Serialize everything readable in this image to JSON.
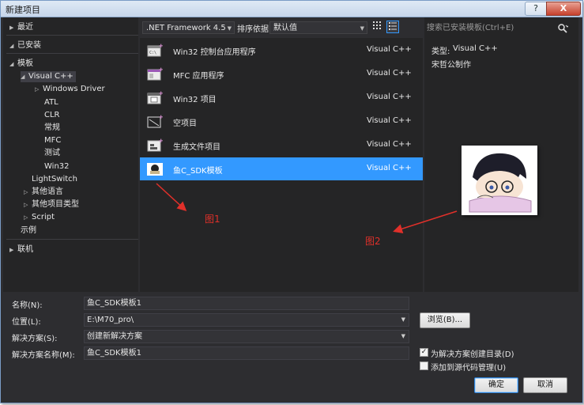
{
  "window": {
    "title": "新建项目",
    "help_glyph": "?",
    "close_glyph": "X"
  },
  "tree": {
    "recent": "最近",
    "installed": "已安装",
    "templates": "模板",
    "visual_cpp": "Visual C++",
    "windows_driver": "Windows Driver",
    "atl": "ATL",
    "clr": "CLR",
    "general": "常规",
    "mfc": "MFC",
    "test": "测试",
    "win32": "Win32",
    "lightswitch": "LightSwitch",
    "other_languages": "其他语言",
    "other_project_types": "其他项目类型",
    "script": "Script",
    "samples": "示例",
    "online": "联机"
  },
  "toolbar": {
    "framework": ".NET Framework 4.5",
    "sort_label": "排序依据:",
    "sort_value": "默认值"
  },
  "templates": [
    {
      "name": "Win32 控制台应用程序",
      "lang": "Visual C++",
      "icon": "console-app-icon"
    },
    {
      "name": "MFC 应用程序",
      "lang": "Visual C++",
      "icon": "mfc-app-icon"
    },
    {
      "name": "Win32 项目",
      "lang": "Visual C++",
      "icon": "win32-project-icon"
    },
    {
      "name": "空项目",
      "lang": "Visual C++",
      "icon": "empty-project-icon"
    },
    {
      "name": "生成文件项目",
      "lang": "Visual C++",
      "icon": "makefile-project-icon"
    },
    {
      "name": "鱼C_SDK模板",
      "lang": "Visual C++",
      "icon": "custom-template-icon"
    }
  ],
  "search": {
    "placeholder": "搜索已安装模板(Ctrl+E)"
  },
  "details": {
    "type_label": "类型:",
    "type_value": "Visual C++",
    "author": "宋哲公制作"
  },
  "annotations": {
    "fig1": "图1",
    "fig2": "图2"
  },
  "form": {
    "name_label": "名称(N):",
    "name_value": "鱼C_SDK模板1",
    "location_label": "位置(L):",
    "location_value": "E:\\M70_pro\\",
    "solution_label": "解决方案(S):",
    "solution_value": "创建新解决方案",
    "solution_name_label": "解决方案名称(M):",
    "solution_name_value": "鱼C_SDK模板1",
    "browse": "浏览(B)...",
    "create_dir": "为解决方案创建目录(D)",
    "add_source_control": "添加到源代码管理(U)",
    "ok": "确定",
    "cancel": "取消"
  },
  "colors": {
    "accent": "#3399ff",
    "annotation": "#e0302a",
    "background": "#2d2d30"
  }
}
